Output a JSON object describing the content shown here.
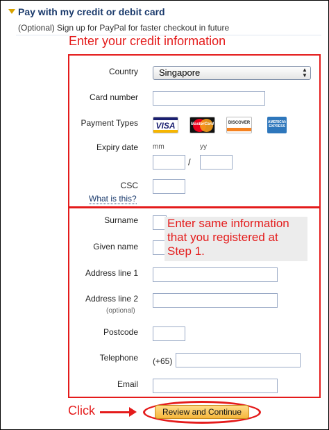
{
  "header": {
    "title": "Pay with my credit or debit card",
    "subtitle": "(Optional) Sign up for PayPal for faster checkout in future"
  },
  "annotations": {
    "top": "Enter your credit information",
    "middle_lines": [
      "Enter same information",
      "that you registered at",
      "Step 1."
    ],
    "click": "Click",
    "color": "#e41b1b"
  },
  "card_section": {
    "country_label": "Country",
    "country_value": "Singapore",
    "card_number_label": "Card number",
    "card_number_value": "",
    "payment_types_label": "Payment Types",
    "cards": [
      {
        "name": "visa-card-icon",
        "label": "VISA"
      },
      {
        "name": "mastercard-card-icon",
        "label": "MasterCard"
      },
      {
        "name": "discover-card-icon",
        "label": "DISCOVER"
      },
      {
        "name": "amex-card-icon",
        "label": "AMERICAN EXPRESS"
      }
    ],
    "expiry_label": "Expiry date",
    "expiry_mm_label": "mm",
    "expiry_yy_label": "yy",
    "expiry_separator": "/",
    "csc_label": "CSC",
    "csc_help_link": "What is this?"
  },
  "address_section": {
    "surname_label": "Surname",
    "given_name_label": "Given name",
    "address1_label": "Address line 1",
    "address2_label": "Address line 2",
    "address2_note": "(optional)",
    "postcode_label": "Postcode",
    "telephone_label": "Telephone",
    "telephone_prefix": "(+65)",
    "email_label": "Email"
  },
  "actions": {
    "review_button": "Review and Continue",
    "button_color": "#f6b73c"
  }
}
